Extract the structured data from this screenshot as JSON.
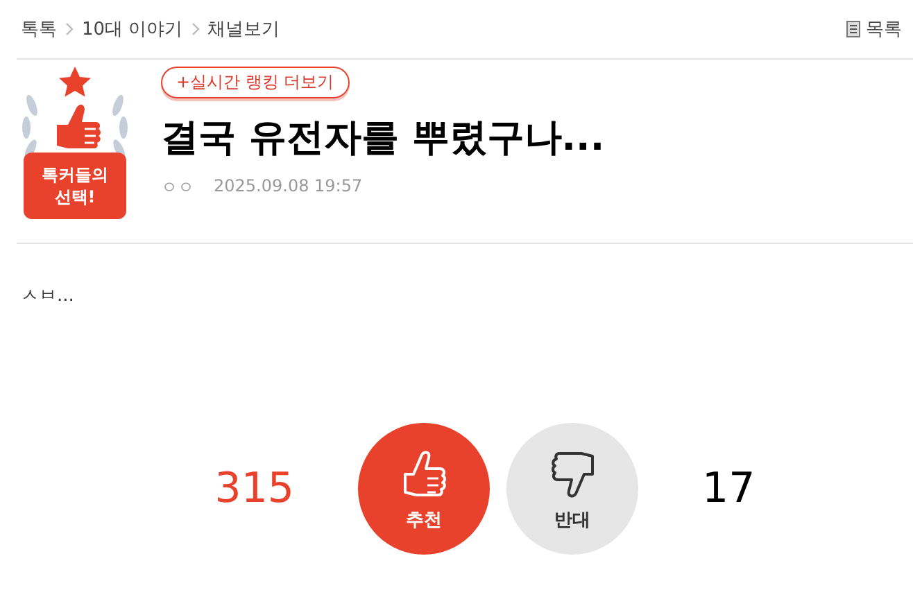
{
  "breadcrumb": [
    {
      "label": "톡톡"
    },
    {
      "label": "10대 이야기"
    },
    {
      "label": "채널보기"
    }
  ],
  "list_link": "목록",
  "badge": {
    "lines": [
      "톡커들의",
      "선택!"
    ]
  },
  "ranking_link": "+실시간 랭킹 더보기",
  "title": "결국 유전자를 뿌렸구나...",
  "author": "ㅇㅇ",
  "date": "2025.09.08 19:57",
  "body": "ㅅㅂ...",
  "votes": [
    {
      "kind": "up",
      "label": "추천",
      "count": "315"
    },
    {
      "kind": "down",
      "label": "반대",
      "count": "17"
    }
  ]
}
